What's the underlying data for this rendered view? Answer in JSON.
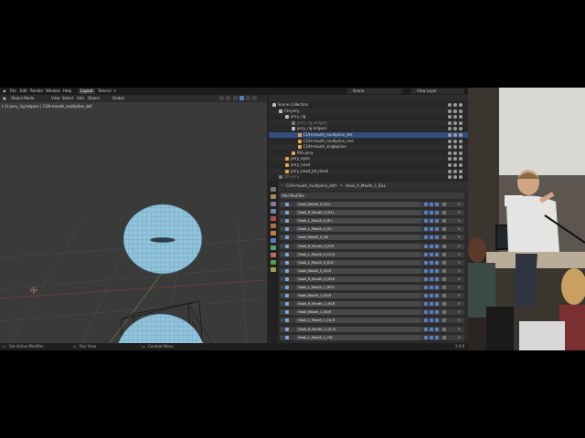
{
  "topbar": {
    "menus": [
      "File",
      "Edit",
      "Render",
      "Window",
      "Help"
    ],
    "workspaces": [
      "Layout",
      "Tutorial"
    ],
    "active_workspace": "Layout",
    "add_tab": "+",
    "scene_label": "Scene",
    "view_layer_label": "View Layer"
  },
  "viewport": {
    "mode": "Object Mode",
    "menus": [
      "View",
      "Select",
      "Add",
      "Object"
    ],
    "transform_orientation": "Global",
    "info_line": "(-1) jerry_rig.helpers | CUH-mouth_multipline_def"
  },
  "outliner": {
    "rows": [
      {
        "label": "Scene Collection",
        "indent": 0,
        "icon": "collection-icon",
        "color": "#bdbdbd"
      },
      {
        "label": "CH-jerry",
        "indent": 1,
        "icon": "collection-icon",
        "color": "#bdbdbd"
      },
      {
        "label": "jerry_rig",
        "indent": 2,
        "icon": "collection-icon",
        "color": "#bdbdbd"
      },
      {
        "label": "jerry_rig.widgets",
        "indent": 3,
        "icon": "collection-icon",
        "color": "#7a7a7a",
        "dim": true
      },
      {
        "label": "jerry_rig.helpers",
        "indent": 3,
        "icon": "collection-icon",
        "color": "#bdbdbd"
      },
      {
        "label": "CUH-mouth_multipline_def",
        "indent": 4,
        "icon": "curve-icon",
        "color": "#e6a54a",
        "selected": true
      },
      {
        "label": "CUH-mouth_multipline_rest",
        "indent": 4,
        "icon": "curve-icon",
        "color": "#e6a54a"
      },
      {
        "label": "CUH-mouth_singlepline",
        "indent": 4,
        "icon": "curve-icon",
        "color": "#e6a54a"
      },
      {
        "label": "RIG-jerry",
        "indent": 3,
        "icon": "armature-icon",
        "color": "#e6a54a"
      },
      {
        "label": "jerry_eyes",
        "indent": 2,
        "icon": "mesh-icon",
        "color": "#e6a54a"
      },
      {
        "label": "jerry_head",
        "indent": 2,
        "icon": "mesh-icon",
        "color": "#e6a54a"
      },
      {
        "label": "jerry_head_lat_mesh",
        "indent": 2,
        "icon": "lattice-icon",
        "color": "#e6a54a"
      },
      {
        "label": "Dfl-jerry",
        "indent": 1,
        "icon": "collection-icon",
        "color": "#7a7a7a",
        "dim": true
      }
    ]
  },
  "properties": {
    "breadcrumb_object": "CUH-mouth_multipline_def",
    "breadcrumb_sep": ">",
    "breadcrumb_modifier": "Hook_R_Mouth_1_IELL",
    "add_modifier": "Add Modifier",
    "modifiers": [
      "Hook_Mouth_0_IELL",
      "Hook_R_Mouth_0_IELL",
      "Hook_L_Mouth_0_IE.L",
      "Hook_L_Mouth_0_00",
      "Hook_Mouth_0_0D",
      "Hook_R_Mouth_0_ELR",
      "Hook_L_Mouth_0_OL.R",
      "Hook_L_Mouth_0_ELR",
      "Hook_Mouth_0_IELR",
      "Hook_R_Mouth_0_IELR",
      "Hook_L_Mouth_1_IELR",
      "Hook_Mouth_1_IELR",
      "Hook_R_Mouth_1_IELR",
      "Hook_Mouth_1_IELR",
      "Hook_L_Mouth_1_OL.R",
      "Hook_R_Mouth_1_OL.R",
      "Hook_L_Mouth_1_OD"
    ]
  },
  "statusbar": {
    "left": "Set Active Modifier",
    "middle": "Pan View",
    "right_menu": "Context Menu",
    "version": "2.9.0"
  },
  "colors": {
    "selection": "#334d80",
    "accent_blue": "#5680c2",
    "object_orange": "#e6a54a",
    "mesh_blue": "#8fc4dc"
  }
}
